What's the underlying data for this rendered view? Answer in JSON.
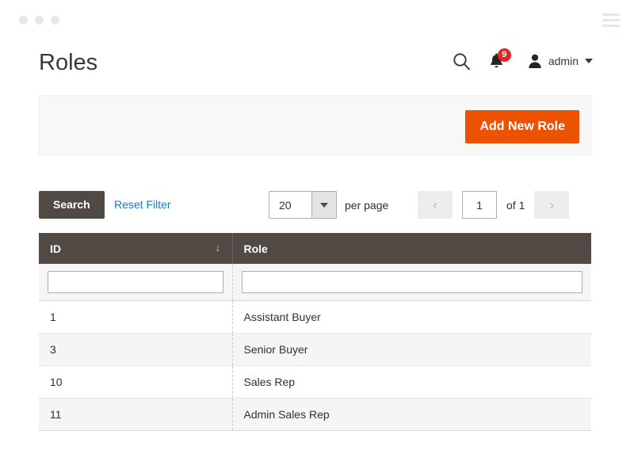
{
  "window": {
    "dots_count": 3,
    "menu_icon": "hamburger-icon"
  },
  "header": {
    "title": "Roles",
    "search_icon": "search-icon",
    "notifications": {
      "icon": "bell-icon",
      "count": "9",
      "badge_color": "#e22626"
    },
    "user": {
      "avatar_icon": "user-avatar-icon",
      "name": "admin",
      "caret_icon": "chevron-down-icon"
    }
  },
  "action_bar": {
    "add_button_label": "Add New Role",
    "add_button_color": "#eb5202"
  },
  "toolbar": {
    "search_label": "Search",
    "search_button_color": "#514943",
    "reset_filter_label": "Reset Filter",
    "reset_filter_color": "#1979c3",
    "per_page_value": "20",
    "per_page_label": "per page",
    "prev_icon": "chevron-left-icon",
    "next_icon": "chevron-right-icon",
    "current_page": "1",
    "total_pages_label": "of 1"
  },
  "grid": {
    "header_color": "#514943",
    "columns": [
      {
        "label": "ID",
        "sort_icon": "arrow-down-icon",
        "sorted": true
      },
      {
        "label": "Role",
        "sort_icon": "",
        "sorted": false
      }
    ],
    "filters": [
      {
        "value": "",
        "placeholder": ""
      },
      {
        "value": "",
        "placeholder": ""
      }
    ],
    "rows": [
      {
        "id": "1",
        "role": "Assistant Buyer"
      },
      {
        "id": "3",
        "role": "Senior Buyer"
      },
      {
        "id": "10",
        "role": "Sales Rep"
      },
      {
        "id": "11",
        "role": "Admin Sales Rep"
      }
    ]
  }
}
